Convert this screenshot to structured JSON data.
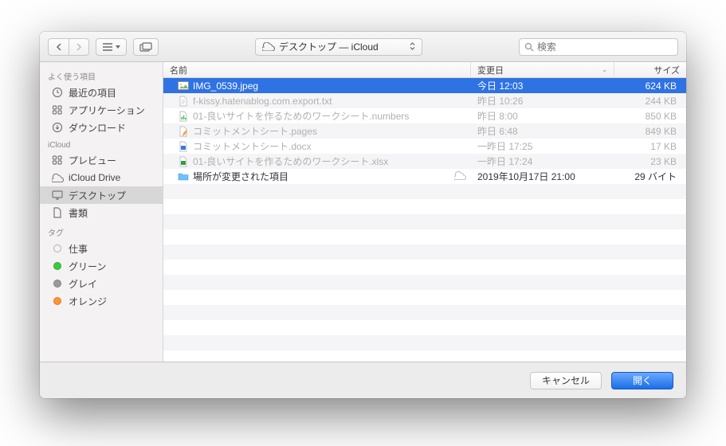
{
  "toolbar": {
    "location_prefix_icon": "cloud",
    "location_label": "デスクトップ — iCloud",
    "search_placeholder": "検索"
  },
  "sidebar": {
    "sections": [
      {
        "title": "よく使う項目",
        "items": [
          {
            "icon": "clock",
            "label": "最近の項目"
          },
          {
            "icon": "apps",
            "label": "アプリケーション"
          },
          {
            "icon": "down",
            "label": "ダウンロード"
          }
        ]
      },
      {
        "title": "iCloud",
        "items": [
          {
            "icon": "apps",
            "label": "プレビュー"
          },
          {
            "icon": "cloud",
            "label": "iCloud Drive"
          },
          {
            "icon": "desktop",
            "label": "デスクトップ",
            "selected": true
          },
          {
            "icon": "doc",
            "label": "書類"
          }
        ]
      },
      {
        "title": "タグ",
        "items": [
          {
            "tag": "empty",
            "label": "仕事"
          },
          {
            "tag": "#3bca3b",
            "label": "グリーン"
          },
          {
            "tag": "#9a9a9a",
            "label": "グレイ"
          },
          {
            "tag": "#ff9433",
            "label": "オレンジ"
          }
        ]
      }
    ]
  },
  "columns": {
    "name": "名前",
    "date": "変更日",
    "size": "サイズ"
  },
  "rows": [
    {
      "icon": "img",
      "name": "IMG_0539.jpeg",
      "date": "今日 12:03",
      "size": "624 KB",
      "selected": true
    },
    {
      "icon": "txt",
      "name": "f-kissy.hatenablog.com.export.txt",
      "date": "昨日 10:26",
      "size": "244 KB",
      "dim": true
    },
    {
      "icon": "num",
      "name": "01-良いサイトを作るためのワークシート.numbers",
      "date": "昨日 8:00",
      "size": "850 KB",
      "dim": true
    },
    {
      "icon": "pages",
      "name": "コミットメントシート.pages",
      "date": "昨日 6:48",
      "size": "849 KB",
      "dim": true
    },
    {
      "icon": "docx",
      "name": "コミットメントシート.docx",
      "date": "一昨日 17:25",
      "size": "17 KB",
      "dim": true
    },
    {
      "icon": "xlsx",
      "name": "01-良いサイトを作るためのワークシート.xlsx",
      "date": "一昨日 17:24",
      "size": "23 KB",
      "dim": true
    },
    {
      "icon": "folder",
      "name": "場所が変更された項目",
      "date": "2019年10月17日 21:00",
      "size": "29 バイト",
      "cloud": true
    }
  ],
  "footer": {
    "cancel": "キャンセル",
    "open": "開く"
  }
}
